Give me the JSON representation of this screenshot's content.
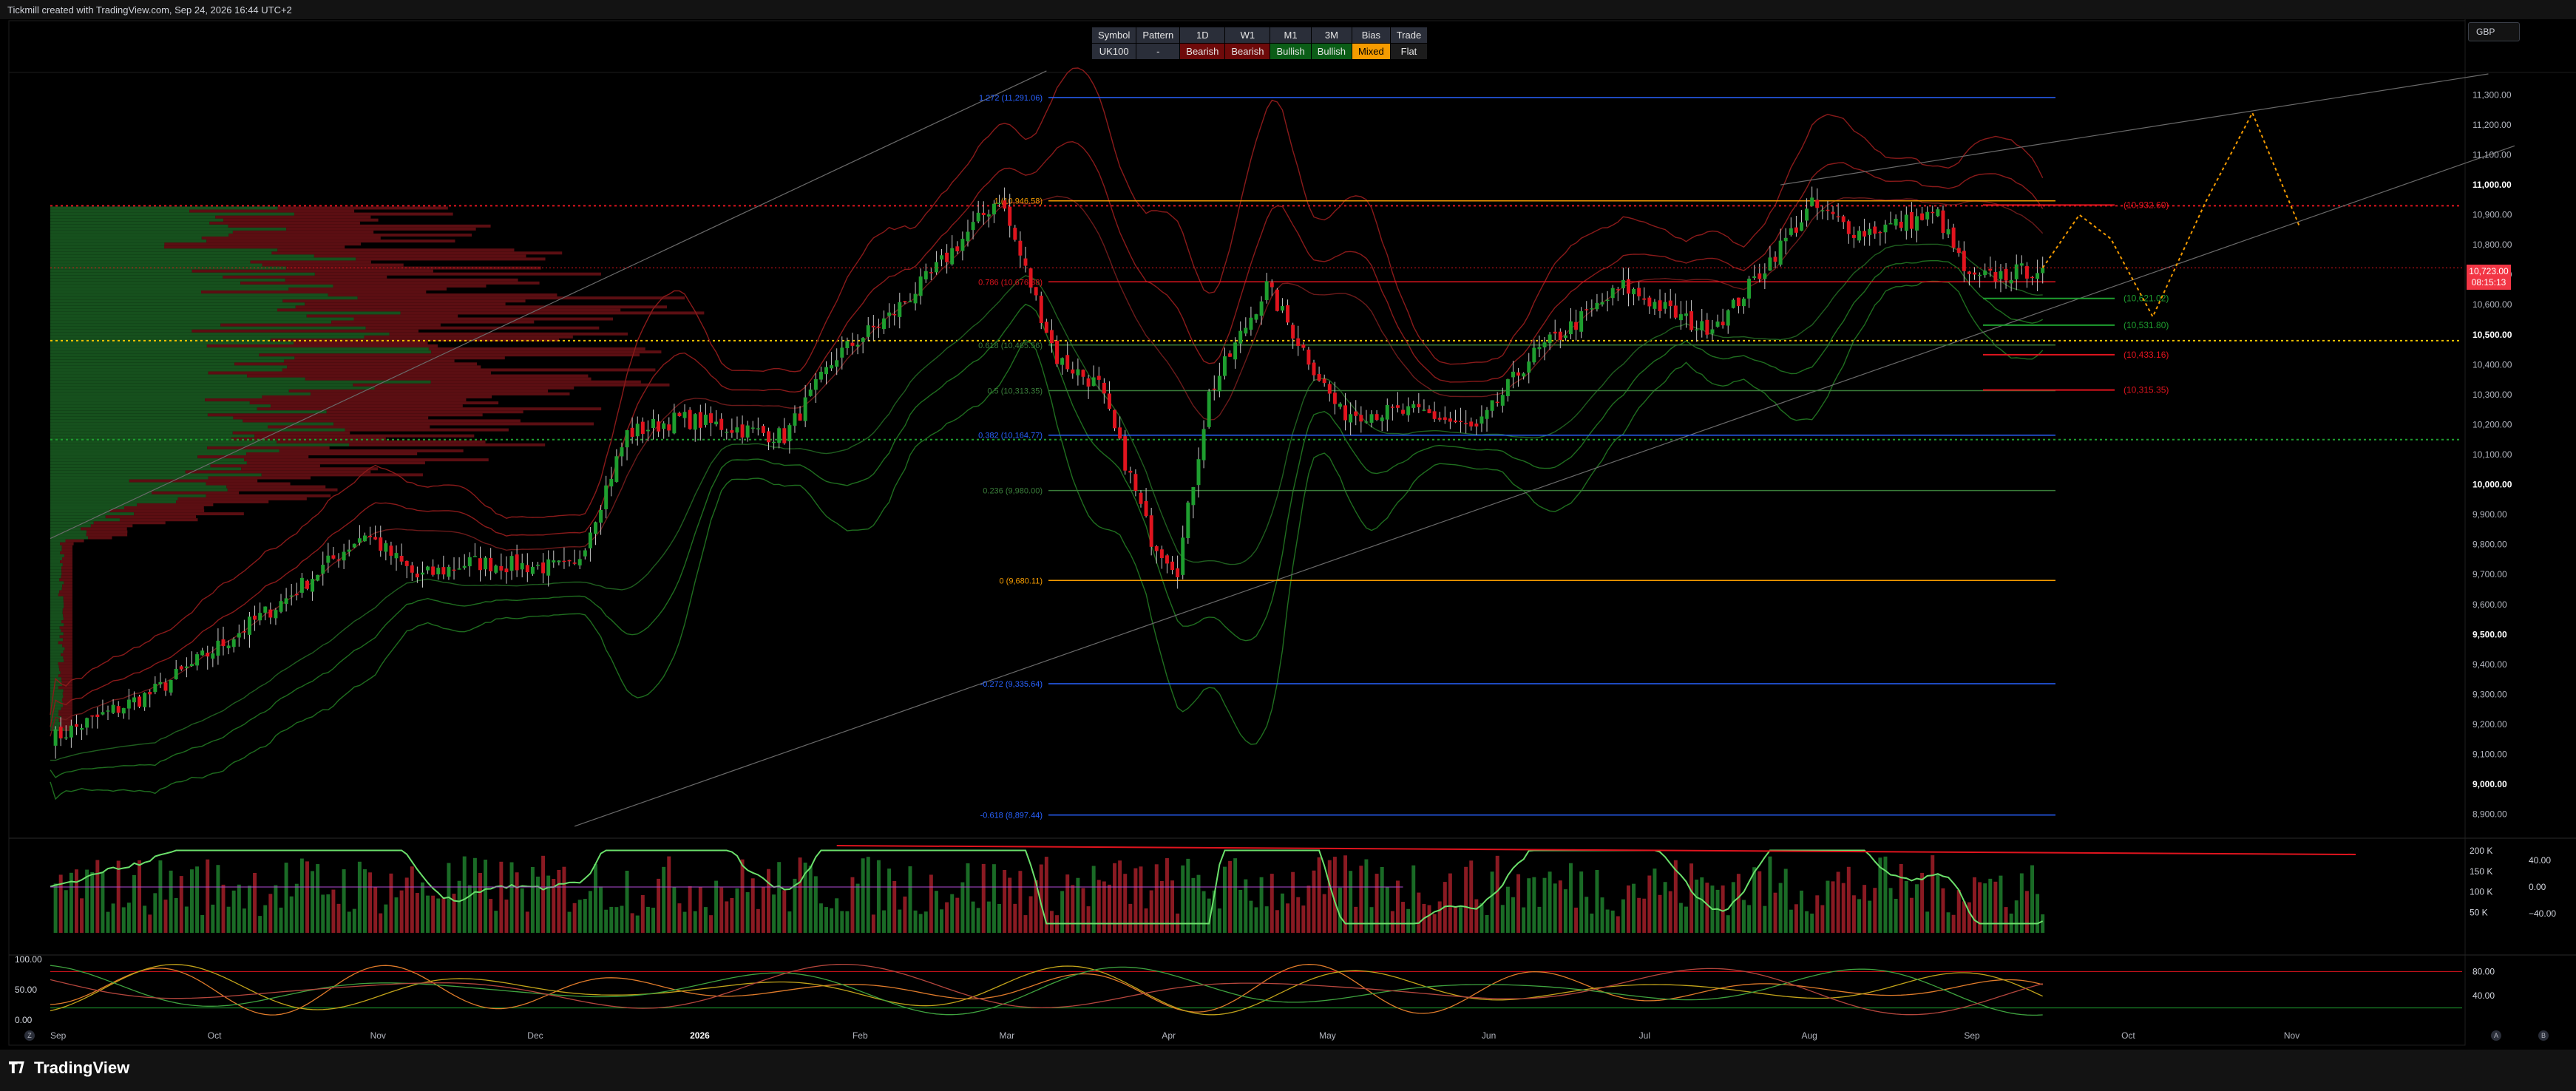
{
  "header": {
    "watermark": "Tickmill created with TradingView.com, Sep 24, 2026 16:44 UTC+2"
  },
  "currency": "GBP",
  "bias_table": {
    "headers": [
      "Symbol",
      "Pattern",
      "1D",
      "W1",
      "M1",
      "3M",
      "Bias",
      "Trade"
    ],
    "row": [
      {
        "text": "UK100",
        "style": "plain"
      },
      {
        "text": "-",
        "style": "plain"
      },
      {
        "text": "Bearish",
        "style": "bear"
      },
      {
        "text": "Bearish",
        "style": "bear"
      },
      {
        "text": "Bullish",
        "style": "bull"
      },
      {
        "text": "Bullish",
        "style": "bull"
      },
      {
        "text": "Mixed",
        "style": "mixed"
      },
      {
        "text": "Flat",
        "style": "flat"
      }
    ]
  },
  "price_tag": {
    "price": "10,723.00",
    "countdown": "08:15:13"
  },
  "footer": {
    "brand": "TradingView",
    "left_buttons": [
      "Z"
    ],
    "right_buttons": [
      "A",
      "B"
    ]
  },
  "colors": {
    "bull": "#1e9e2f",
    "bear": "#e0141e",
    "fib_orange": "#f59b00",
    "fib_blue": "#2962ff",
    "background": "#000000"
  },
  "chart_data": [
    {
      "type": "candlestick",
      "title": "",
      "y_axis": {
        "ylim": [
          8830,
          11370
        ],
        "ticks": [
          "11,300.00",
          "11,200.00",
          "11,100.00",
          "11,000.00",
          "10,900.00",
          "10,800.00",
          "10,700.00",
          "10,600.00",
          "10,500.00",
          "10,400.00",
          "10,300.00",
          "10,200.00",
          "10,100.00",
          "10,000.00",
          "9,900.00",
          "9,800.00",
          "9,700.00",
          "9,600.00",
          "9,500.00",
          "9,400.00",
          "9,300.00",
          "9,200.00",
          "9,100.00",
          "9,000.00",
          "8,900.00"
        ],
        "tick_values": [
          11300,
          11200,
          11100,
          11000,
          10900,
          10800,
          10700,
          10600,
          10500,
          10400,
          10300,
          10200,
          10100,
          10000,
          9900,
          9800,
          9700,
          9600,
          9500,
          9400,
          9300,
          9200,
          9100,
          9000,
          8900
        ],
        "bold_ticks": [
          11000,
          10500,
          10000,
          9500,
          9000
        ]
      },
      "x_axis": {
        "labels": [
          "Sep",
          "Oct",
          "Nov",
          "Dec",
          "2026",
          "Feb",
          "Mar",
          "Apr",
          "May",
          "Jun",
          "Jul",
          "Aug",
          "Sep",
          "Oct",
          "Nov"
        ],
        "label_days": [
          0,
          30,
          61,
          91,
          122,
          153,
          181,
          212,
          242,
          273,
          303,
          334,
          365,
          395,
          426
        ],
        "bold_labels": [
          "2026"
        ]
      },
      "anchor_days": [
        0,
        20,
        45,
        60,
        70,
        80,
        100,
        110,
        120,
        140,
        150,
        160,
        168,
        181,
        192,
        200,
        210,
        215,
        221,
        232,
        246,
        262,
        272,
        282,
        300,
        315,
        320,
        336,
        345,
        360,
        366,
        380
      ],
      "anchor_closes": [
        9150,
        9310,
        9620,
        9840,
        9690,
        9740,
        9720,
        10170,
        10220,
        10160,
        10430,
        10560,
        10700,
        10960,
        10420,
        10330,
        9820,
        9720,
        10300,
        10660,
        10240,
        10240,
        10180,
        10420,
        10660,
        10520,
        10570,
        10930,
        10840,
        10900,
        10680,
        10723
      ],
      "volume_profile": {
        "price_range": [
          9180,
          10920
        ],
        "poc": 10480,
        "value_area_high": 10930,
        "value_area_low": 10150
      },
      "fibonacci": [
        {
          "label": "1.272 (11,291.06)",
          "value": 11291.06,
          "color": "#2962ff"
        },
        {
          "label": "1 (10,946.58)",
          "value": 10946.58,
          "color": "#f59b00"
        },
        {
          "label": "0.786 (10,676.38)",
          "value": 10676.38,
          "color": "#e0141e"
        },
        {
          "label": "0.618 (10,465.56)",
          "value": 10465.56,
          "color": "#3a7d3a"
        },
        {
          "label": "0.5 (10,313.35)",
          "value": 10313.35,
          "color": "#3a7d3a"
        },
        {
          "label": "0.382 (10,164.77)",
          "value": 10164.77,
          "color": "#2962ff"
        },
        {
          "label": "0.236 (9,980.00)",
          "value": 9980.0,
          "color": "#3a7d3a"
        },
        {
          "label": "0 (9,680.11)",
          "value": 9680.11,
          "color": "#f59b00"
        },
        {
          "label": "-0.272 (9,335.64)",
          "value": 9335.64,
          "color": "#2962ff"
        },
        {
          "label": "-0.618 (8,897.44)",
          "value": 8897.44,
          "color": "#2962ff"
        }
      ],
      "levels": [
        {
          "label": "(10,932.60)",
          "value": 10932.6,
          "color": "#e0141e"
        },
        {
          "label": "(10,621.02)",
          "value": 10621.02,
          "color": "#1e9e2f"
        },
        {
          "label": "(10,531.80)",
          "value": 10531.8,
          "color": "#1e9e2f"
        },
        {
          "label": "(10,433.16)",
          "value": 10433.16,
          "color": "#e0141e"
        },
        {
          "label": "(10,315.35)",
          "value": 10315.35,
          "color": "#e0141e"
        }
      ],
      "projection_path": {
        "days": [
          380,
          387,
          393,
          401,
          411,
          420,
          429
        ],
        "values": [
          10723,
          10900,
          10820,
          10560,
          10940,
          11240,
          10860
        ]
      }
    },
    {
      "type": "bar",
      "title": "",
      "y_axis": {
        "ticks": [
          "200 K",
          "150 K",
          "100 K",
          "50 K"
        ],
        "tick_values": [
          200,
          150,
          100,
          50
        ]
      },
      "oscillator_ticks": [
        "40.00",
        "0.00",
        "−40.00"
      ],
      "oscillator_values": [
        40,
        0,
        -40
      ]
    },
    {
      "type": "line",
      "title": "",
      "y_axis_left": {
        "ticks": [
          "100.00",
          "50.00",
          "0.00"
        ],
        "tick_values": [
          100,
          50,
          0
        ]
      },
      "y_axis_right": {
        "ticks": [
          "80.00",
          "40.00"
        ],
        "tick_values": [
          80,
          40
        ]
      }
    }
  ]
}
